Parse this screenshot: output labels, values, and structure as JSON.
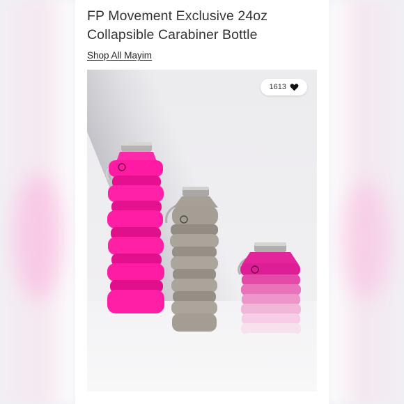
{
  "product": {
    "title": "FP Movement Exclusive 24oz Collapsible Carabiner Bottle",
    "shop_link": "Shop All Mayim"
  },
  "likes": {
    "count": "1613",
    "icon": "heart-icon"
  },
  "colors": {
    "pink_bottle": "#ff1fa6",
    "gray_bottle": "#a8a298",
    "ombre_top": "#e2259a",
    "ombre_bottom": "#f5f3f4",
    "cap_metal": "#b8b6b4"
  }
}
